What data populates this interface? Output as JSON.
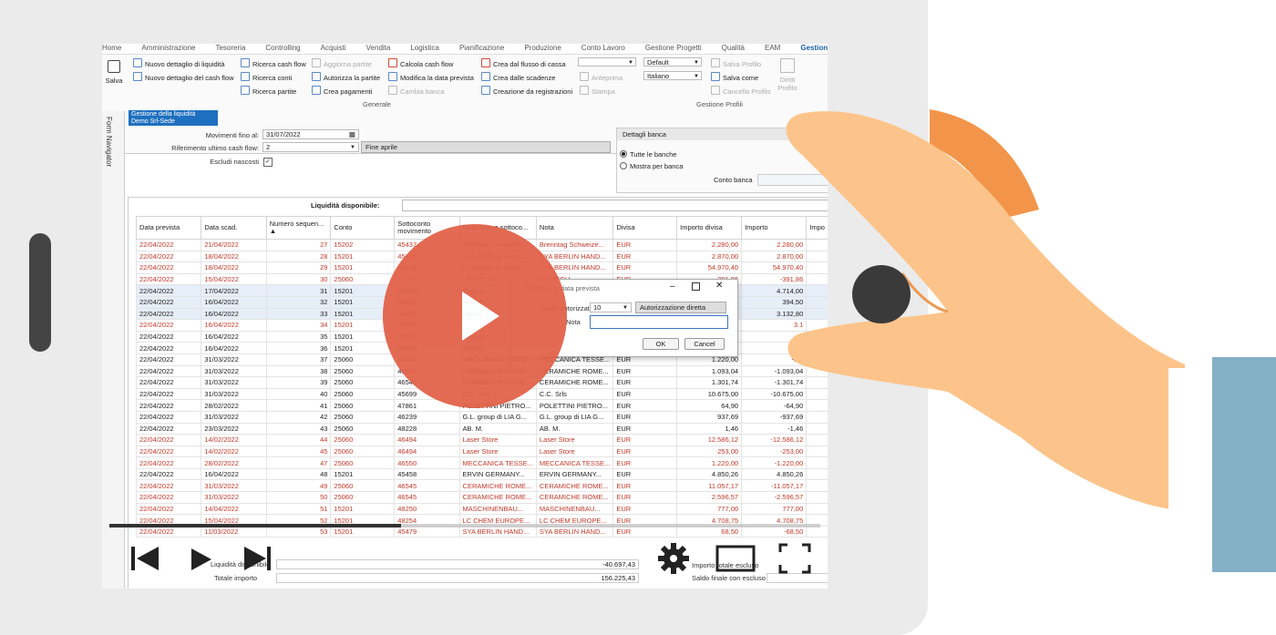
{
  "menu": [
    "Home",
    "Amministrazione",
    "Tesoreria",
    "Controlling",
    "Acquisti",
    "Vendita",
    "Logistica",
    "Pianificazione",
    "Produzione",
    "Conto Lavoro",
    "Gestione Progetti",
    "Qualità",
    "EAM",
    "Gestione de"
  ],
  "ribbon": {
    "save": "Salva",
    "nuovo_liquidita": "Nuovo dettaglio di liquidità",
    "nuovo_cashflow": "Nuovo dettaglio del cash flow",
    "ricerca_cashflow": "Ricerca cash flow",
    "ricerca_conti": "Ricerca conti",
    "ricerca_partite": "Ricerca partite",
    "aggiorna_partite": "Aggiorna partite",
    "autorizza_partite": "Autorizza la partite",
    "crea_pagamenti": "Crea pagamenti",
    "calcola_cashflow": "Calcola cash flow",
    "modifica_data": "Modifica la data prevista",
    "cambia_banca": "Cambia banca",
    "crea_flusso": "Crea dal flusso di cassa",
    "crea_scadenze": "Crea dalle scadenze",
    "creazione_registrazioni": "Creazione da registrazioni",
    "anteprima": "Anteprima",
    "stampa": "Stampa",
    "profile_default": "Default",
    "profile_lang": "Italiano",
    "salva_profilo": "Salva Profilo",
    "salva_come": "Salva come",
    "cancella_profilo": "Cancella Profilo",
    "diritti": "Diritti",
    "profilo": "Profilo",
    "group_generale": "Generale",
    "group_profili": "Gestione Profili"
  },
  "sidebar_label": "Form Navigator",
  "doc_tab": {
    "line1": "Gestione della liquidità",
    "line2": "Demo Srl-Sede"
  },
  "filters": {
    "movimenti_label": "Movimenti fino al:",
    "movimenti_value": "31/07/2022",
    "riferimento_label": "Riferimento ultimo cash flow:",
    "riferimento_value": "2",
    "riferimento_desc": "Fine aprile",
    "escludi_label": "Escludi nascosti",
    "liquidita_label": "Liquidità disponibile:"
  },
  "bank": {
    "header": "Dettagli banca",
    "opt_all": "Tutte le banche",
    "opt_per": "Mostra per banca",
    "conto_label": "Conto banca"
  },
  "grid": {
    "headers": [
      "Data prevista",
      "Data scad.",
      "Numero sequen... ▲",
      "Conto",
      "Sottoconto movimento",
      "Descrizione sottoco...",
      "Nota",
      "Divisa",
      "Importo divisa",
      "Importo",
      "Impo"
    ],
    "rows": [
      {
        "style": "red",
        "c": [
          "22/04/2022",
          "21/04/2022",
          "27",
          "15202",
          "45437",
          "Brenntag Schweize...",
          "Brenntag Schweize...",
          "EUR",
          "2.280,00",
          "2.280,00"
        ]
      },
      {
        "style": "red",
        "c": [
          "22/04/2022",
          "18/04/2022",
          "28",
          "15201",
          "45479",
          "SYA BERLIN HAND...",
          "SYA BERLIN HAND...",
          "EUR",
          "2.870,00",
          "2.870,00"
        ]
      },
      {
        "style": "red",
        "c": [
          "22/04/2022",
          "18/04/2022",
          "29",
          "15201",
          "45479",
          "SYA BERLIN HAND...",
          "SYA BERLIN HAND...",
          "EUR",
          "54.970,40",
          "54.970,40"
        ]
      },
      {
        "style": "red",
        "c": [
          "22/04/2022",
          "15/04/2022",
          "30",
          "25060",
          "47750",
          "UNITECH",
          "UNITECH",
          "EUR",
          "-391,86",
          "-391,86"
        ]
      },
      {
        "style": "blue",
        "c": [
          "22/04/2022",
          "17/04/2022",
          "31",
          "15201",
          "47310",
          "Togo S...",
          "",
          "",
          "",
          "4.714,00"
        ]
      },
      {
        "style": "blue",
        "c": [
          "22/04/2022",
          "16/04/2022",
          "32",
          "15201",
          "45461",
          "Haniel",
          "",
          "",
          "50",
          "394,50"
        ]
      },
      {
        "style": "blue",
        "c": [
          "22/04/2022",
          "16/04/2022",
          "33",
          "15201",
          "45461",
          "Haniel",
          "",
          "",
          "80",
          "3.132,80"
        ]
      },
      {
        "style": "red",
        "c": [
          "22/04/2022",
          "16/04/2022",
          "34",
          "15201",
          "45462",
          "",
          "",
          "",
          "80",
          "3.1"
        ]
      },
      {
        "style": "",
        "c": [
          "22/04/2022",
          "16/04/2022",
          "35",
          "15201",
          "47573",
          "Novary",
          "",
          "",
          "00",
          ""
        ]
      },
      {
        "style": "",
        "c": [
          "22/04/2022",
          "16/04/2022",
          "36",
          "15201",
          "45480",
          "Hypers",
          "",
          "",
          "13",
          ""
        ]
      },
      {
        "style": "",
        "c": [
          "22/04/2022",
          "31/03/2022",
          "37",
          "25060",
          "46550",
          "MECCANICA TESSE...",
          "MECCANICA TESSE...",
          "EUR",
          "1.220,00",
          "-1.2"
        ]
      },
      {
        "style": "",
        "c": [
          "22/04/2022",
          "31/03/2022",
          "38",
          "25060",
          "46545",
          "CERAMICHE ROME...",
          "CERAMICHE ROME...",
          "EUR",
          "1.093,04",
          "-1.093,04"
        ]
      },
      {
        "style": "",
        "c": [
          "22/04/2022",
          "31/03/2022",
          "39",
          "25060",
          "46545",
          "CERAMICHE ROME...",
          "CERAMICHE ROME...",
          "EUR",
          "1.301,74",
          "-1.301,74"
        ]
      },
      {
        "style": "",
        "c": [
          "22/04/2022",
          "31/03/2022",
          "40",
          "25060",
          "45699",
          "C.C. Srls",
          "C.C. Srls",
          "EUR",
          "10.675,00",
          "-10.675,00"
        ]
      },
      {
        "style": "",
        "c": [
          "22/04/2022",
          "28/02/2022",
          "41",
          "25060",
          "47861",
          "POLETTINI PIETRO...",
          "POLETTINI PIETRO...",
          "EUR",
          "64,90",
          "-64,90"
        ]
      },
      {
        "style": "",
        "c": [
          "22/04/2022",
          "31/03/2022",
          "42",
          "25060",
          "46239",
          "G.L. group di LIA G...",
          "G.L. group di LIA G...",
          "EUR",
          "937,69",
          "-937,69"
        ]
      },
      {
        "style": "",
        "c": [
          "22/04/2022",
          "23/03/2022",
          "43",
          "25060",
          "48228",
          "AB. M.",
          "AB. M.",
          "EUR",
          "1,46",
          "-1,46"
        ]
      },
      {
        "style": "red",
        "c": [
          "22/04/2022",
          "14/02/2022",
          "44",
          "25060",
          "46494",
          "Laser Store",
          "Laser Store",
          "EUR",
          "12.586,12",
          "-12.586,12"
        ]
      },
      {
        "style": "red",
        "c": [
          "22/04/2022",
          "14/02/2022",
          "45",
          "25060",
          "46494",
          "Laser Store",
          "Laser Store",
          "EUR",
          "253,00",
          "-253,00"
        ]
      },
      {
        "style": "red",
        "c": [
          "22/04/2022",
          "28/02/2022",
          "47",
          "25060",
          "46550",
          "MECCANICA TESSE...",
          "MECCANICA TESSE...",
          "EUR",
          "1.220,00",
          "-1.220,00"
        ]
      },
      {
        "style": "",
        "c": [
          "22/04/2022",
          "16/04/2022",
          "48",
          "15201",
          "45458",
          "ERVIN GERMANY...",
          "ERVIN GERMANY...",
          "EUR",
          "4.850,26",
          "4.850,26"
        ]
      },
      {
        "style": "red",
        "c": [
          "22/04/2022",
          "31/03/2022",
          "49",
          "25060",
          "46545",
          "CERAMICHE ROME...",
          "CERAMICHE ROME...",
          "EUR",
          "11.057,17",
          "-11.057,17"
        ]
      },
      {
        "style": "red",
        "c": [
          "22/04/2022",
          "31/03/2022",
          "50",
          "25060",
          "46545",
          "CERAMICHE ROME...",
          "CERAMICHE ROME...",
          "EUR",
          "2.596,57",
          "-2.596,57"
        ]
      },
      {
        "style": "red",
        "c": [
          "22/04/2022",
          "14/04/2022",
          "51",
          "15201",
          "48250",
          "MASCHINENBAU...",
          "MASCHINENBAU...",
          "EUR",
          "777,00",
          "777,00"
        ]
      },
      {
        "style": "red",
        "c": [
          "22/04/2022",
          "15/04/2022",
          "52",
          "15201",
          "48254",
          "LC CHEM EUROPE...",
          "LC CHEM EUROPE...",
          "EUR",
          "4.708,75",
          "4.708,75"
        ]
      },
      {
        "style": "red",
        "c": [
          "22/04/2022",
          "11/03/2022",
          "53",
          "15201",
          "45479",
          "SYA BERLIN HAND...",
          "SYA BERLIN HAND...",
          "EUR",
          "68,50",
          "-68,50"
        ]
      }
    ]
  },
  "dialog": {
    "title": "Modifica la data prevista",
    "livello_label": "Livello autorizzativo",
    "livello_value": "10",
    "autorizzazione": "Autorizzazione diretta",
    "nota_label": "Nota",
    "ok": "OK",
    "cancel": "Cancel"
  },
  "footer": {
    "liquidita_label": "Liquidità disponibile",
    "liquidita_value": "-40.697,43",
    "totale_label": "Totale importo",
    "totale_value": "156.225,43",
    "importo_escluso": "Importo totale escluso",
    "saldo_escluso": "Saldo finale con escluso"
  },
  "video": {
    "progress": 0.41
  },
  "colors": {
    "accent": "#1e6fbf",
    "play": "#e2624a",
    "hand": "#fcc48a",
    "sleeve": "#84b0c6",
    "red_text": "#c0392b"
  }
}
